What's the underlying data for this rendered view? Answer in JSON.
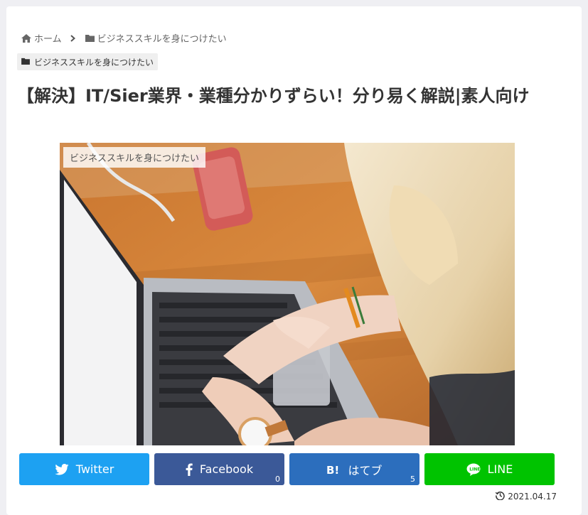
{
  "breadcrumb": {
    "home_label": "ホーム",
    "category_label": "ビジネススキルを身につけたい"
  },
  "category_label": "ビジネススキルを身につけたい",
  "article": {
    "title": "【解決】IT/Sier業界・業種分かりずらい！分り易く解説|素人向け",
    "date": "2021.04.17"
  },
  "hero": {
    "badge": "ビジネススキルを身につけたい"
  },
  "share": {
    "twitter": {
      "label": "Twitter",
      "color": "#1da1f2"
    },
    "facebook": {
      "label": "Facebook",
      "count": "0",
      "color": "#3b5998"
    },
    "hatena": {
      "label": "はてブ",
      "count": "5",
      "color": "#2c6ebd"
    },
    "line": {
      "label": "LINE",
      "color": "#00c300"
    }
  }
}
